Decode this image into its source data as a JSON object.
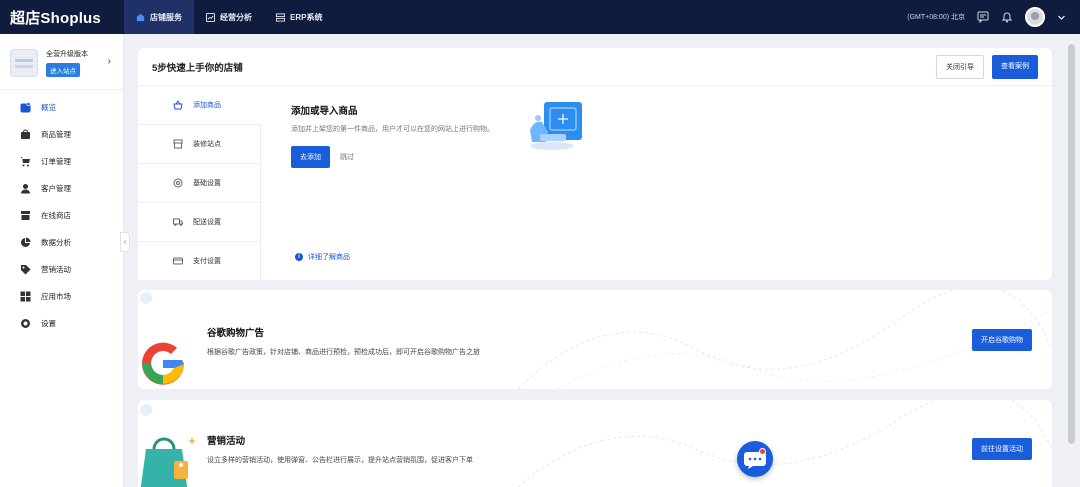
{
  "app": {
    "logo": "超店Shoplus"
  },
  "topnav": {
    "items": [
      {
        "label": "店铺服务",
        "icon": "store-icon"
      },
      {
        "label": "经营分析",
        "icon": "chart-icon"
      },
      {
        "label": "ERP系统",
        "icon": "erp-icon"
      }
    ],
    "timezone": "(GMT+08:00) 北京"
  },
  "sidebar": {
    "plan_text": "全营升级版本",
    "enter_store": "进入站点",
    "items": [
      {
        "label": "概览",
        "icon": "overview-icon"
      },
      {
        "label": "商品管理",
        "icon": "product-icon"
      },
      {
        "label": "订单管理",
        "icon": "cart-icon"
      },
      {
        "label": "客户管理",
        "icon": "user-icon"
      },
      {
        "label": "在线商店",
        "icon": "shop-icon"
      },
      {
        "label": "数据分析",
        "icon": "pie-icon"
      },
      {
        "label": "营销活动",
        "icon": "tag-icon"
      },
      {
        "label": "应用市场",
        "icon": "apps-icon"
      },
      {
        "label": "设置",
        "icon": "settings-icon"
      }
    ]
  },
  "guide": {
    "title": "5步快速上手你的店铺",
    "close_label": "关闭引导",
    "cases_label": "查看案例",
    "steps": [
      {
        "label": "添加商品"
      },
      {
        "label": "装修站点"
      },
      {
        "label": "基础设置"
      },
      {
        "label": "配送设置"
      },
      {
        "label": "支付设置"
      }
    ],
    "active": {
      "title": "添加或导入商品",
      "desc": "添加并上架您的第一件商品，用户才可以在您的网站上进行购物。",
      "add_label": "去添加",
      "skip_label": "跳过"
    },
    "learn_more": "详细了解商品"
  },
  "promos": {
    "ads": {
      "title": "谷歌购物广告",
      "desc": "根据谷歌广告政策，针对店铺、商品进行预检，预检成功后，即可开启谷歌购物广告之旅",
      "button": "开启谷歌购物"
    },
    "marketing": {
      "title": "营销活动",
      "desc": "设立多样的营销活动，使用弹窗、公告栏进行展示，提升站点营销氛围，促进客户下单",
      "button": "前往设置活动"
    }
  },
  "colors": {
    "primary": "#1a5ddb",
    "topbar": "#0f1c3d",
    "active_nav": "#1f3166"
  }
}
